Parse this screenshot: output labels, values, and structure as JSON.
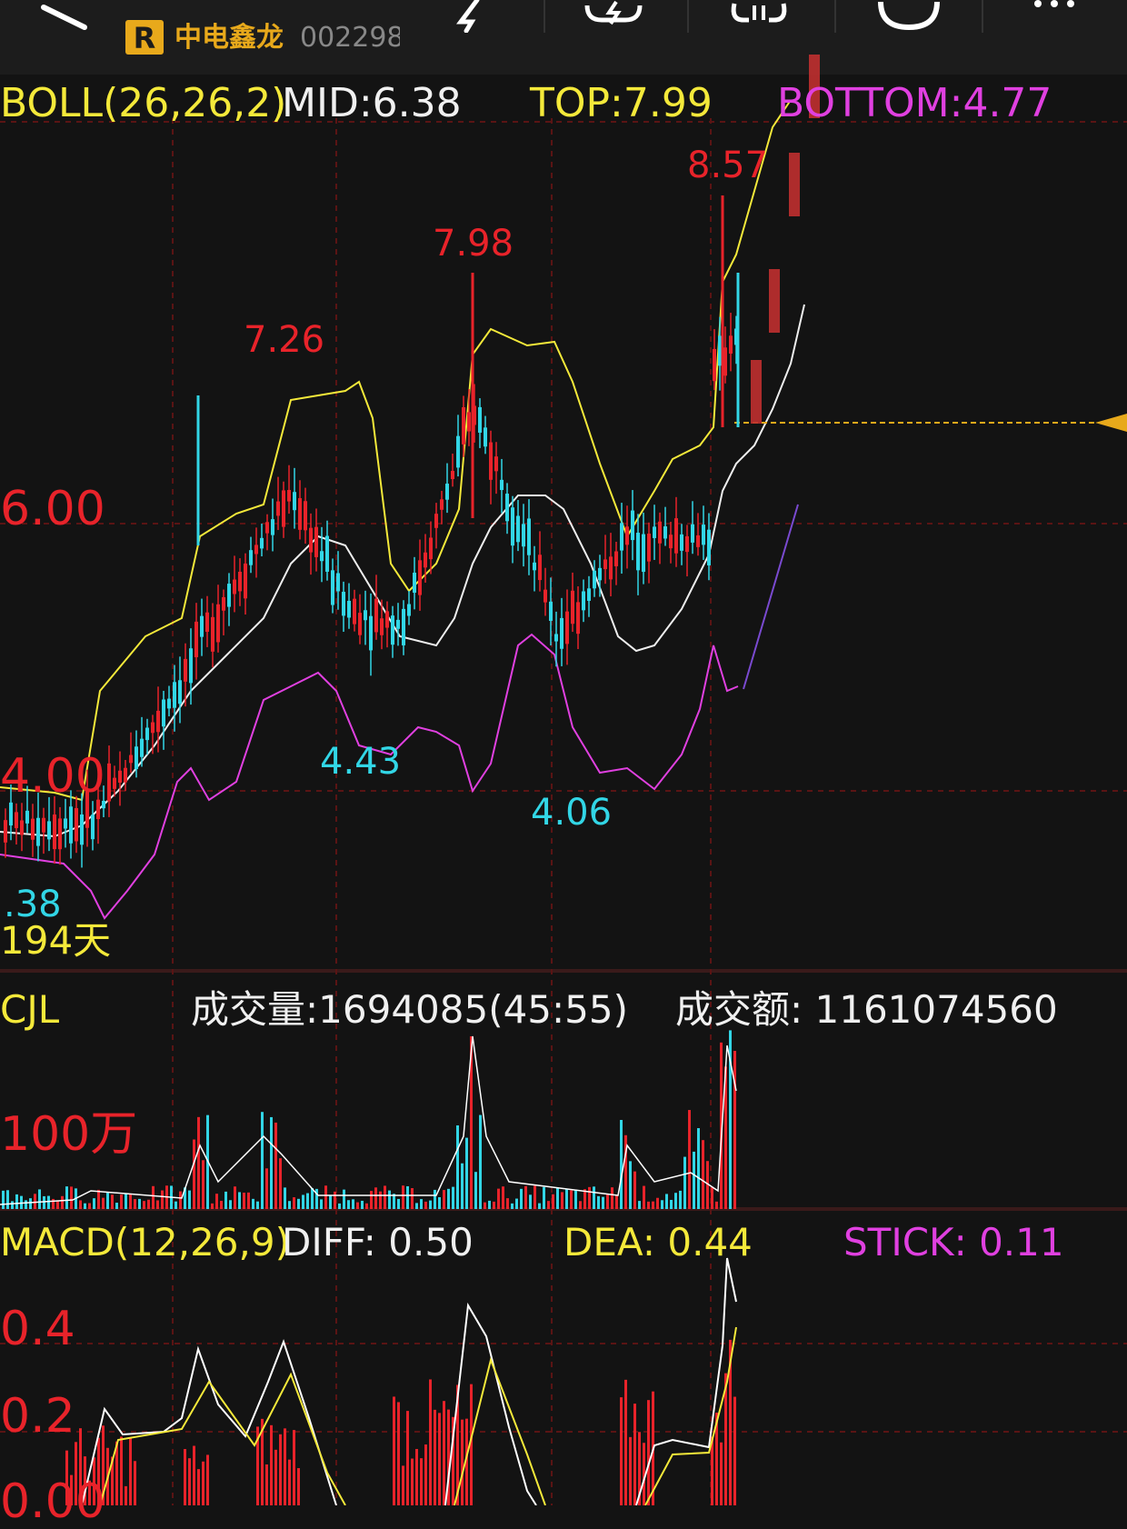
{
  "header": {
    "badge": "R",
    "stock_name": "中电鑫龙",
    "stock_code": "002298"
  },
  "boll": {
    "label": "BOLL(26,26,2)",
    "mid": "MID:6.38",
    "top": "TOP:7.99",
    "bottom": "BOTTOM:4.77"
  },
  "price_chart": {
    "axis_6": "6.00",
    "axis_4": "4.00",
    "peak1": "7.26",
    "peak2": "7.98",
    "peak3": "8.57",
    "low1": "4.43",
    "low2": "4.06",
    "low0": ".38",
    "days": "194天"
  },
  "volume": {
    "label": "CJL",
    "volume_text": "成交量:1694085(45:55)",
    "amount_text": "成交额: 1161074560",
    "axis": "100万"
  },
  "macd": {
    "label": "MACD(12,26,9)",
    "diff": "DIFF: 0.50",
    "dea": "DEA: 0.44",
    "stick": "STICK: 0.11",
    "axis_04": "0.4",
    "axis_02": "0.2",
    "axis_00": "0.00"
  },
  "colors": {
    "background": "#131313",
    "yellow": "#f4e93a",
    "red": "#e8232a",
    "cyan": "#32d6e6",
    "magenta": "#e040e0",
    "accent": "#e8a91b"
  }
}
